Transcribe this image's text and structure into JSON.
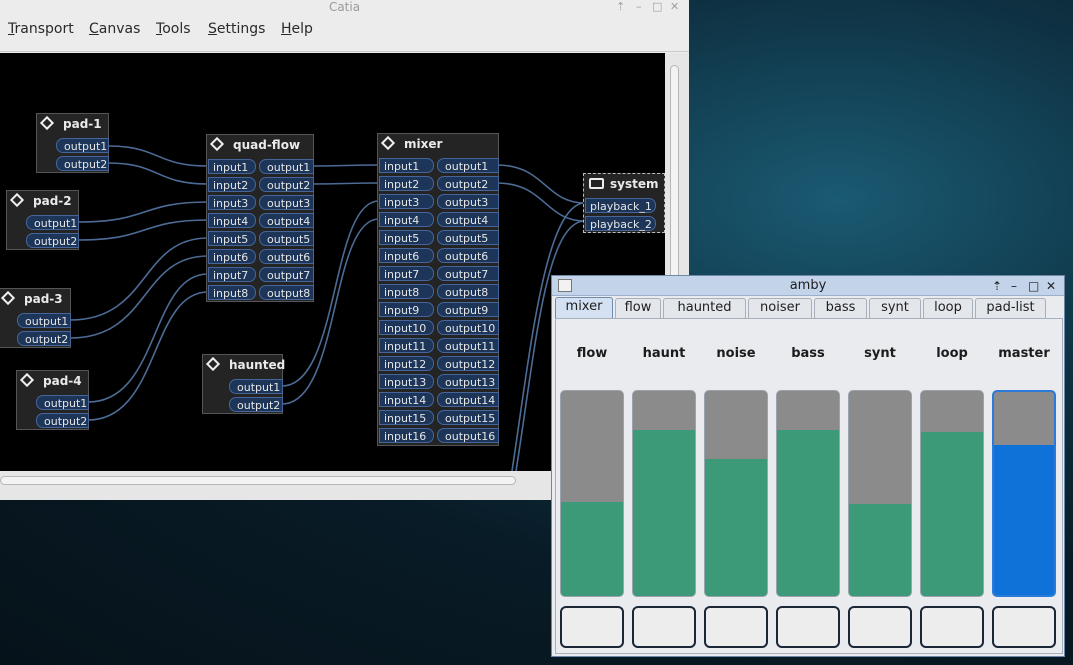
{
  "catia": {
    "title": "Catia",
    "menu": [
      {
        "label": "Transport",
        "key": "T",
        "rest": "ransport"
      },
      {
        "label": "Canvas",
        "key": "C",
        "rest": "anvas"
      },
      {
        "label": "Tools",
        "key": "T",
        "rest": "ools"
      },
      {
        "label": "Settings",
        "key": "S",
        "rest": "ettings"
      },
      {
        "label": "Help",
        "key": "H",
        "rest": "elp"
      }
    ],
    "boxes": {
      "pad1": {
        "title": "pad-1",
        "outputs": [
          "output1",
          "output2"
        ]
      },
      "pad2": {
        "title": "pad-2",
        "outputs": [
          "output1",
          "output2"
        ]
      },
      "pad3": {
        "title": "pad-3",
        "outputs": [
          "output1",
          "output2"
        ]
      },
      "pad4": {
        "title": "pad-4",
        "outputs": [
          "output1",
          "output2"
        ]
      },
      "quadflow": {
        "title": "quad-flow",
        "inputs": [
          "input1",
          "input2",
          "input3",
          "input4",
          "input5",
          "input6",
          "input7",
          "input8"
        ],
        "outputs": [
          "output1",
          "output2",
          "output3",
          "output4",
          "output5",
          "output6",
          "output7",
          "output8"
        ]
      },
      "haunted": {
        "title": "haunted",
        "outputs": [
          "output1",
          "output2"
        ]
      },
      "mixer": {
        "title": "mixer",
        "inputs": [
          "input1",
          "input2",
          "input3",
          "input4",
          "input5",
          "input6",
          "input7",
          "input8",
          "input9",
          "input10",
          "input11",
          "input12",
          "input13",
          "input14",
          "input15",
          "input16"
        ],
        "outputs": [
          "output1",
          "output2",
          "output3",
          "output4",
          "output5",
          "output6",
          "output7",
          "output8",
          "output9",
          "output10",
          "output11",
          "output12",
          "output13",
          "output14",
          "output15",
          "output16"
        ]
      },
      "system": {
        "title": "system",
        "inputs": [
          "playback_1",
          "playback_2"
        ]
      }
    }
  },
  "amby": {
    "title": "amby",
    "tabs": [
      "mixer",
      "flow",
      "haunted",
      "noiser",
      "bass",
      "synt",
      "loop",
      "pad-list"
    ],
    "active_tab": "mixer",
    "channels": [
      {
        "label": "flow",
        "level": 0.46
      },
      {
        "label": "haunt",
        "level": 0.81
      },
      {
        "label": "noise",
        "level": 0.67
      },
      {
        "label": "bass",
        "level": 0.81
      },
      {
        "label": "synt",
        "level": 0.45
      },
      {
        "label": "loop",
        "level": 0.8
      },
      {
        "label": "master",
        "level": 0.74
      }
    ],
    "colors": {
      "fader_fill": "#3c9a78",
      "fader_track": "#8b8b8b",
      "master_fill": "#0f72d8"
    }
  }
}
